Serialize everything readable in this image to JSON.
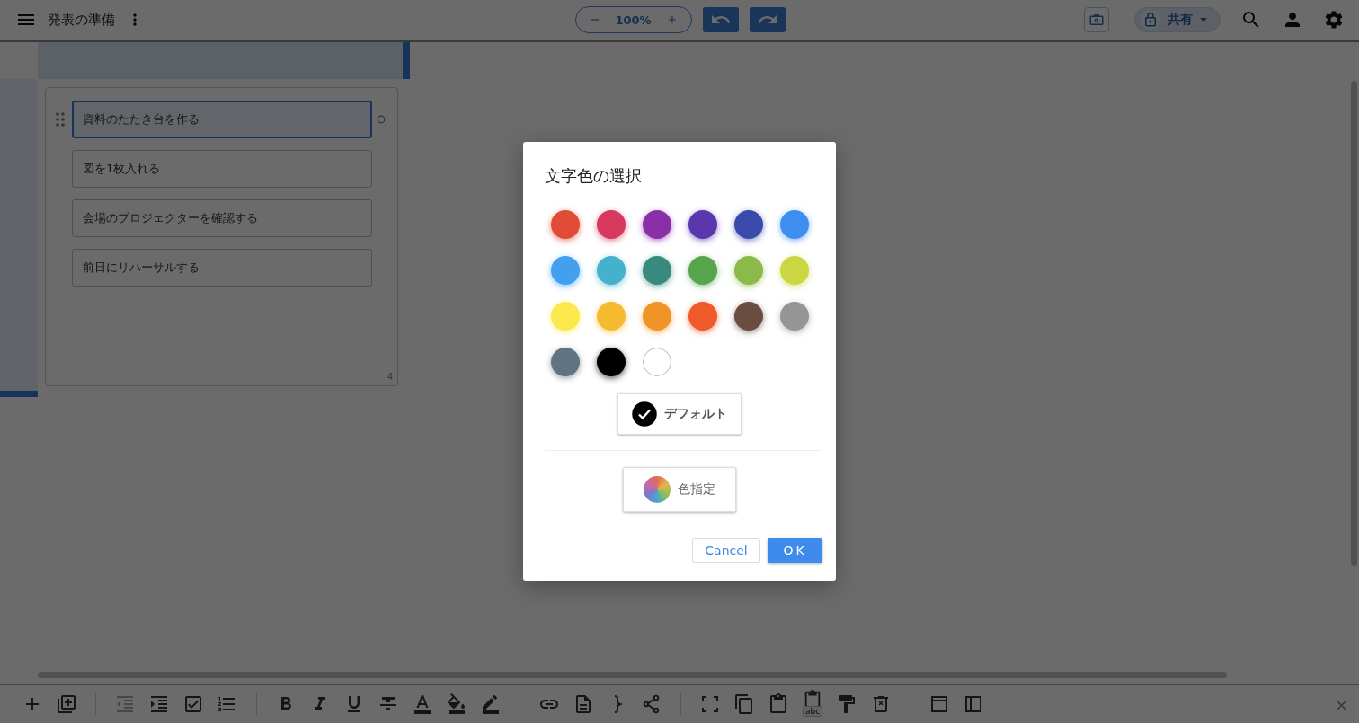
{
  "header": {
    "title": "発表の準備",
    "zoom": "100%",
    "share": "共有"
  },
  "card": {
    "items": [
      {
        "text": "資料のたたき台を作る",
        "selected": true
      },
      {
        "text": "図を1枚入れる",
        "selected": false
      },
      {
        "text": "会場のプロジェクターを確認する",
        "selected": false
      },
      {
        "text": "前日にリハーサルする",
        "selected": false
      }
    ],
    "count": "4"
  },
  "toolbar": {
    "paste_badge": "abc",
    "close": "×"
  },
  "dialog": {
    "title": "文字色の選択",
    "swatches": [
      {
        "color": "#e04b35",
        "selected": false
      },
      {
        "color": "#d6385e",
        "selected": false
      },
      {
        "color": "#8a2fa8",
        "selected": false
      },
      {
        "color": "#5b37ad",
        "selected": false
      },
      {
        "color": "#3a4aaa",
        "selected": false
      },
      {
        "color": "#3e8ef0",
        "selected": false
      },
      {
        "color": "#42a0ef",
        "selected": false
      },
      {
        "color": "#46b1cc",
        "selected": false
      },
      {
        "color": "#378a7c",
        "selected": false
      },
      {
        "color": "#57a44d",
        "selected": false
      },
      {
        "color": "#8bb94a",
        "selected": false
      },
      {
        "color": "#cbd643",
        "selected": false
      },
      {
        "color": "#fbe84b",
        "selected": false
      },
      {
        "color": "#f5bb30",
        "selected": false
      },
      {
        "color": "#f09427",
        "selected": false
      },
      {
        "color": "#ee5a2a",
        "selected": false
      },
      {
        "color": "#6a4d40",
        "selected": false
      },
      {
        "color": "#959595",
        "selected": false
      },
      {
        "color": "#5f7482",
        "selected": false
      },
      {
        "color": "#000000",
        "selected": false
      },
      {
        "color": "#ffffff",
        "selected": false
      }
    ],
    "default": {
      "label": "デフォルト",
      "selected": true
    },
    "custom": {
      "label": "色指定"
    },
    "buttons": {
      "cancel": "Cancel",
      "ok": "OK"
    }
  }
}
